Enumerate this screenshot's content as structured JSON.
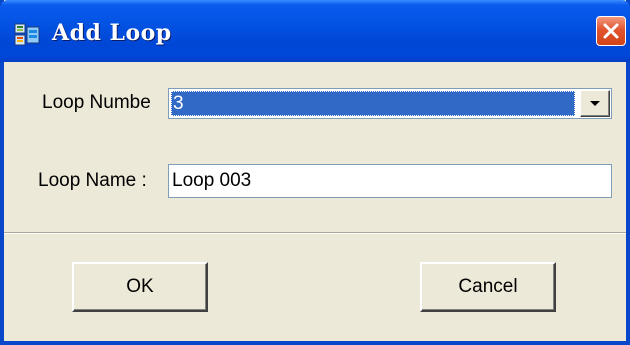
{
  "window": {
    "title": "Add Loop",
    "icon": "app-icon",
    "close_icon": "close-icon",
    "titlebar_color": "#0047d6",
    "close_color": "#e1542f"
  },
  "form": {
    "loop_number_label": "Loop Numbe",
    "loop_number_value": "3",
    "loop_number_selected_color": "#3169c6",
    "loop_name_label": "Loop Name :",
    "loop_name_value": "Loop 003"
  },
  "buttons": {
    "ok_label": "OK",
    "cancel_label": "Cancel"
  }
}
